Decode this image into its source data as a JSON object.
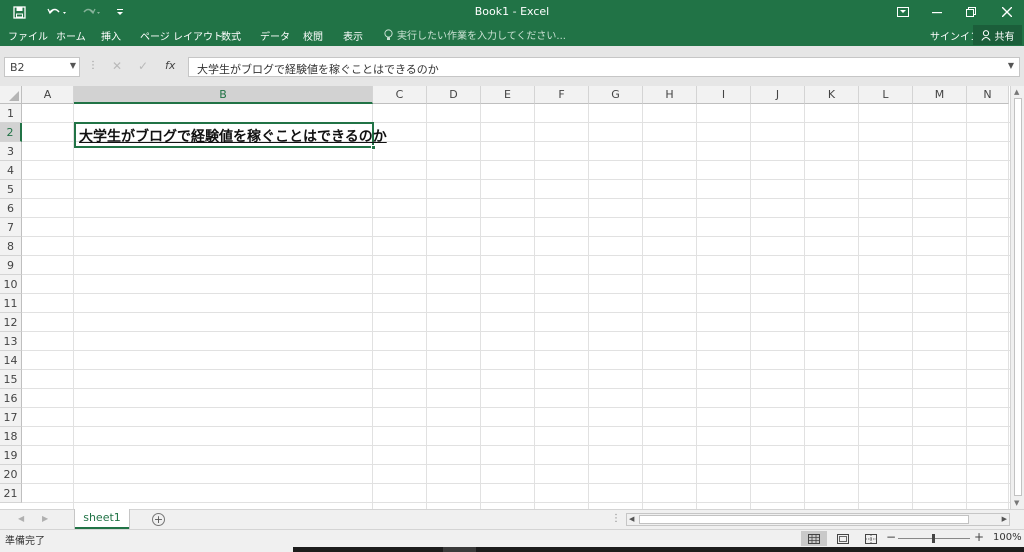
{
  "window": {
    "title": "Book1 - Excel",
    "quick_access": [
      "save-icon",
      "undo-icon",
      "redo-icon",
      "customize-icon"
    ]
  },
  "ribbon": {
    "tabs": [
      "ファイル",
      "ホーム",
      "挿入",
      "ページ レイアウト",
      "数式",
      "データ",
      "校閲",
      "表示"
    ],
    "tell_me": "実行したい作業を入力してください...",
    "signin": "サインイン",
    "share": "共有"
  },
  "formula_bar": {
    "name_box": "B2",
    "fx": "fx",
    "content": "大学生がブログで経験値を稼ぐことはできるのか"
  },
  "sheet": {
    "columns": [
      "A",
      "B",
      "C",
      "D",
      "E",
      "F",
      "G",
      "H",
      "I",
      "J",
      "K",
      "L",
      "M",
      "N"
    ],
    "rows": [
      "1",
      "2",
      "3",
      "4",
      "5",
      "6",
      "7",
      "8",
      "9",
      "10",
      "11",
      "12",
      "13",
      "14",
      "15",
      "16",
      "17",
      "18",
      "19",
      "20",
      "21"
    ],
    "selected_column": "B",
    "selected_row": "2",
    "cells": {
      "B2": "大学生がブログで経験値を稼ぐことはできるのか"
    }
  },
  "sheet_tabs": {
    "tabs": [
      "sheet1"
    ],
    "active": "sheet1"
  },
  "status": {
    "ready": "準備完了",
    "zoom": "100%"
  },
  "colors": {
    "accent": "#217346",
    "header_bg": "#f2f2f2",
    "selected_header_bg": "#d2d2d2"
  }
}
